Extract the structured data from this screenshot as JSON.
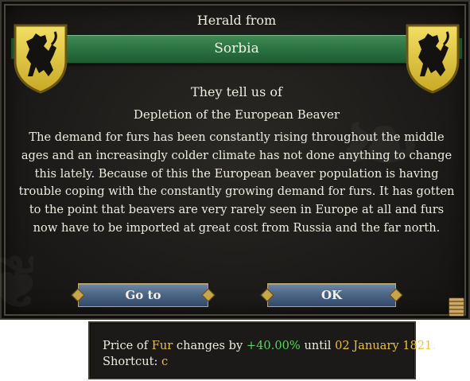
{
  "event": {
    "herald_label": "Herald from",
    "country": "Sorbia",
    "intro": "They tell us of",
    "title": "Depletion of the European Beaver",
    "body": "The demand for furs has been constantly rising throughout the middle ages and an increasingly colder climate has not done anything to change this lately. Because of this the European beaver population is having trouble coping with the constantly growing demand for furs. It has gotten to the point that beavers are very rarely seen in Europe at all and furs now have to be imported at great cost from Russia and the far north."
  },
  "buttons": {
    "goto_label": "Go to",
    "ok_label": "OK"
  },
  "tooltip": {
    "price_prefix": "Price of",
    "good": "Fur",
    "changes_by": "changes by",
    "change": "+40.00%",
    "until": "until",
    "date": "02 January 1821",
    "period": ".",
    "shortcut_label": "Shortcut:",
    "shortcut_key": "c"
  },
  "icons": {
    "coat_of_arms": "black-lion-on-gold-shield-icon",
    "scroll": "scroll-icon"
  },
  "colors": {
    "banner_green": "#2c7442",
    "shield_gold": "#e3c83c",
    "button_blue": "#4d6786",
    "highlight_gold": "#e7c04b",
    "positive_green": "#5bd35b"
  }
}
